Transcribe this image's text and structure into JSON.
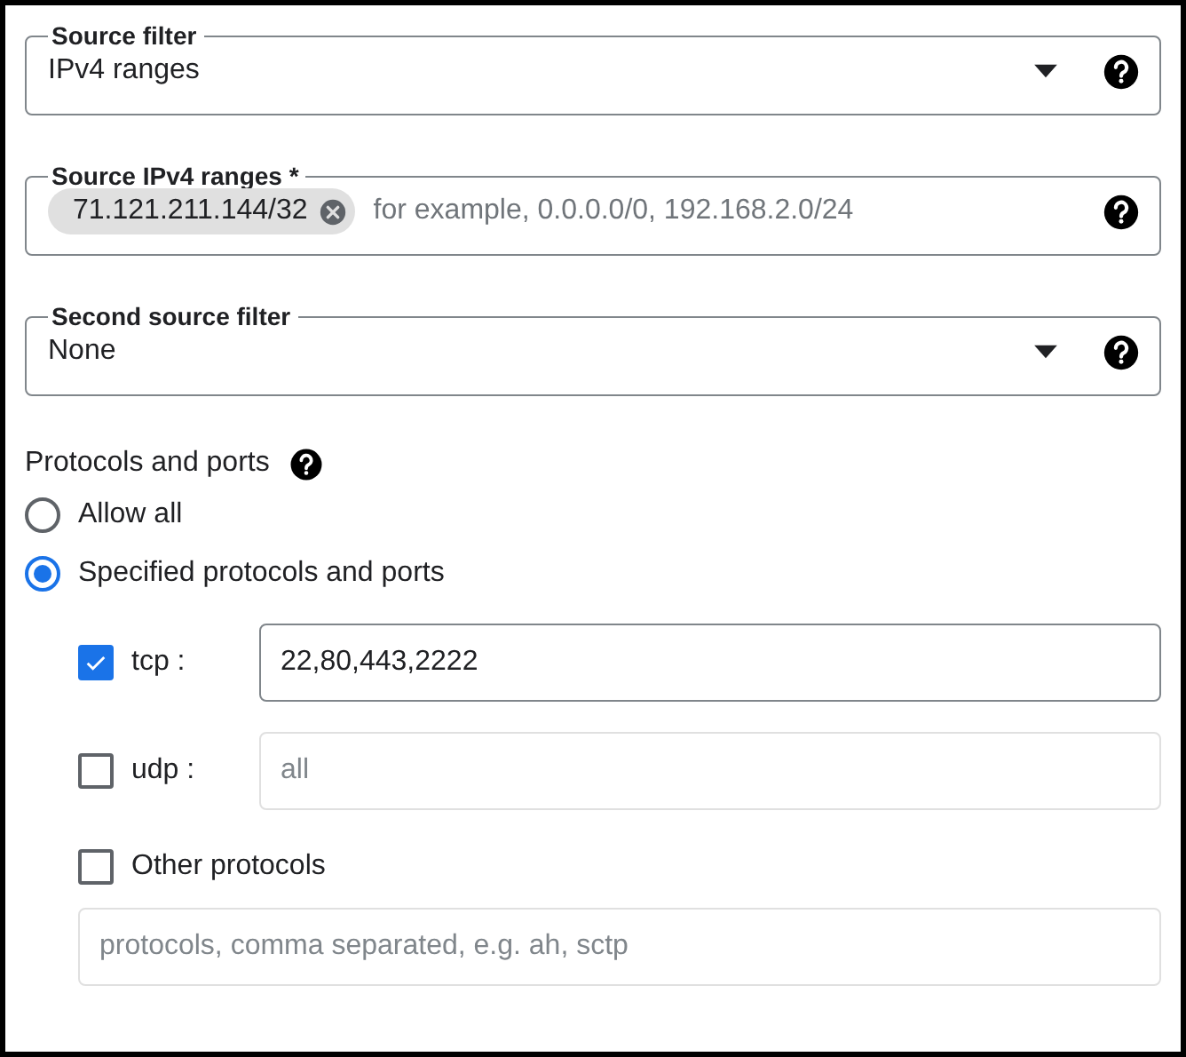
{
  "fields": [
    {
      "kind": "select",
      "label": "Source filter",
      "value": "IPv4 ranges"
    },
    {
      "kind": "chips",
      "label": "Source IPv4 ranges *",
      "chips": [
        {
          "text": "71.121.211.144/32"
        }
      ],
      "placeholder": "for example, 0.0.0.0/0, 192.168.2.0/24"
    },
    {
      "kind": "select",
      "label": "Second source filter",
      "value": "None"
    }
  ],
  "protocols": {
    "title": "Protocols and ports",
    "options": [
      {
        "label": "Allow all",
        "selected": false
      },
      {
        "label": "Specified protocols and ports",
        "selected": true
      }
    ],
    "rows": [
      {
        "kind": "inline",
        "label": "tcp :",
        "checked": true,
        "value": "22,80,443,2222"
      },
      {
        "kind": "inline",
        "label": "udp :",
        "checked": false,
        "placeholder": "all"
      },
      {
        "kind": "stacked",
        "label": "Other protocols",
        "checked": false,
        "placeholder": "protocols, comma separated, e.g. ah, sctp"
      }
    ]
  }
}
